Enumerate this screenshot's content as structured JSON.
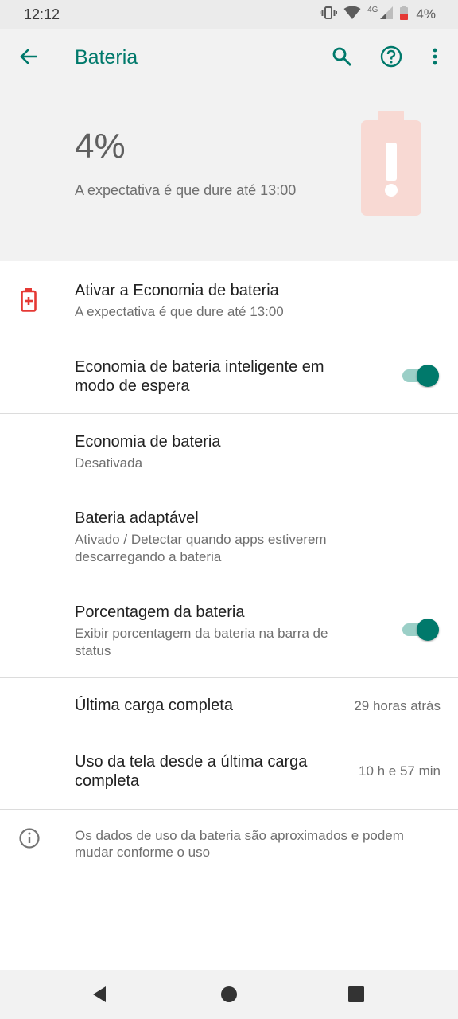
{
  "status_bar": {
    "time": "12:12",
    "network_label": "4G",
    "battery_percent": "4%"
  },
  "header": {
    "title": "Bateria",
    "battery_level": "4%",
    "estimate": "A expectativa é que dure até 13:00"
  },
  "rows": {
    "saver_cta": {
      "title": "Ativar a Economia de bateria",
      "subtitle": "A expectativa é que dure até 13:00"
    },
    "smart_standby": {
      "title_line1": "Economia de bateria inteligente em",
      "title_line2": "modo de espera",
      "enabled": true
    },
    "battery_saver": {
      "title": "Economia de bateria",
      "subtitle": "Desativada"
    },
    "adaptive_battery": {
      "title": "Bateria adaptável",
      "subtitle_line1": "Ativado / Detectar quando apps estiverem",
      "subtitle_line2": "descarregando a bateria"
    },
    "battery_percentage": {
      "title": "Porcentagem da bateria",
      "subtitle_line1": "Exibir porcentagem da bateria na barra de",
      "subtitle_line2": "status",
      "enabled": true
    },
    "last_full_charge": {
      "title": "Última carga completa",
      "value": "29 horas atrás"
    },
    "screen_usage": {
      "title_line1": "Uso da tela desde a última carga",
      "title_line2": "completa",
      "value": "10 h e 57 min"
    }
  },
  "footer_info": {
    "line1": "Os dados de uso da bateria são aproximados e podem",
    "line2": "mudar conforme o uso"
  },
  "colors": {
    "accent": "#00796b",
    "header_bg": "#f2f2f2",
    "warning_red": "#e53935",
    "battery_graphic": "#f8d9d3"
  },
  "icons": [
    "back-arrow-icon",
    "search-icon",
    "help-icon",
    "more-vert-icon",
    "battery-alert-icon",
    "info-icon",
    "vibrate-icon",
    "wifi-icon",
    "signal-icon",
    "battery-icon"
  ]
}
